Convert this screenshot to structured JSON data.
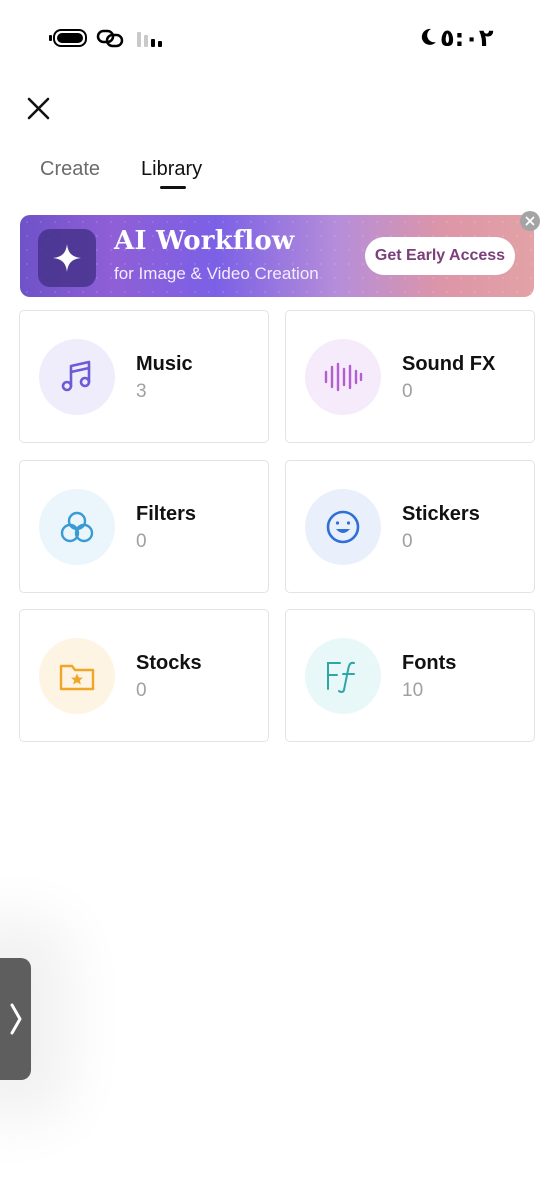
{
  "status_bar": {
    "time": "٥:٠٢"
  },
  "header": {
    "tabs": [
      {
        "label": "Create",
        "active": false
      },
      {
        "label": "Library",
        "active": true
      }
    ]
  },
  "banner": {
    "title": "AI Workflow",
    "subtitle": "for Image & Video Creation",
    "cta_label": "Get Early Access"
  },
  "cards": [
    {
      "title": "Music",
      "count": "3",
      "icon": "music-note-icon",
      "icon_color": "#6b5bd6",
      "bg": "#efedfb"
    },
    {
      "title": "Sound FX",
      "count": "0",
      "icon": "waveform-icon",
      "icon_color": "#b35fcf",
      "bg": "#f5ebfa"
    },
    {
      "title": "Filters",
      "count": "0",
      "icon": "filters-icon",
      "icon_color": "#3a9bd4",
      "bg": "#ebf5fc"
    },
    {
      "title": "Stickers",
      "count": "0",
      "icon": "smiley-icon",
      "icon_color": "#2f6fd6",
      "bg": "#e9f0fb"
    },
    {
      "title": "Stocks",
      "count": "0",
      "icon": "folder-star-icon",
      "icon_color": "#f0a626",
      "bg": "#fdf4e4"
    },
    {
      "title": "Fonts",
      "count": "10",
      "icon": "fonts-icon",
      "icon_color": "#2fa6a6",
      "bg": "#e8f8f8"
    }
  ],
  "colors": {
    "accent_text": "#7b3f7a",
    "handle": "#5e5e5e"
  }
}
